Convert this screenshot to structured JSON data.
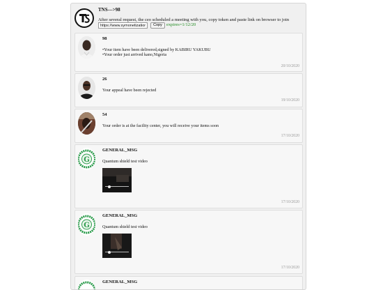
{
  "header": {
    "title": "TNS--->98",
    "notice": "After several request, the ceo scheduled a meeting with you, copy token and paste link on browser to join",
    "link_value": "https://www.symonetization.",
    "copy_label": "Copy",
    "expires": "expires=1/12/20"
  },
  "messages": [
    {
      "sender": "98",
      "lines": [
        "•Your item have been delivered,signed by KABIRU YAKUBU",
        "•Your order just arrived kano,Nigeria"
      ],
      "date": "20/10/2020"
    },
    {
      "sender": "26",
      "lines": [
        "Your appeal have been rejected"
      ],
      "date": "19/10/2020"
    },
    {
      "sender": "54",
      "lines": [
        "Your order is at the facility center, you will receive your items soon"
      ],
      "date": "17/10/2020"
    },
    {
      "sender": "GENERAL_MSG",
      "lines": [
        "Quantum shield test video"
      ],
      "date": "17/10/2020"
    },
    {
      "sender": "GENERAL_MSG",
      "lines": [
        "Quantum shield test video"
      ],
      "date": "17/10/2020"
    },
    {
      "sender": "GENERAL_MSG",
      "lines": [],
      "date": ""
    }
  ],
  "colors": {
    "expires": "#1e8a1e",
    "seal_green": "#2a9a4a",
    "date": "#999999"
  }
}
